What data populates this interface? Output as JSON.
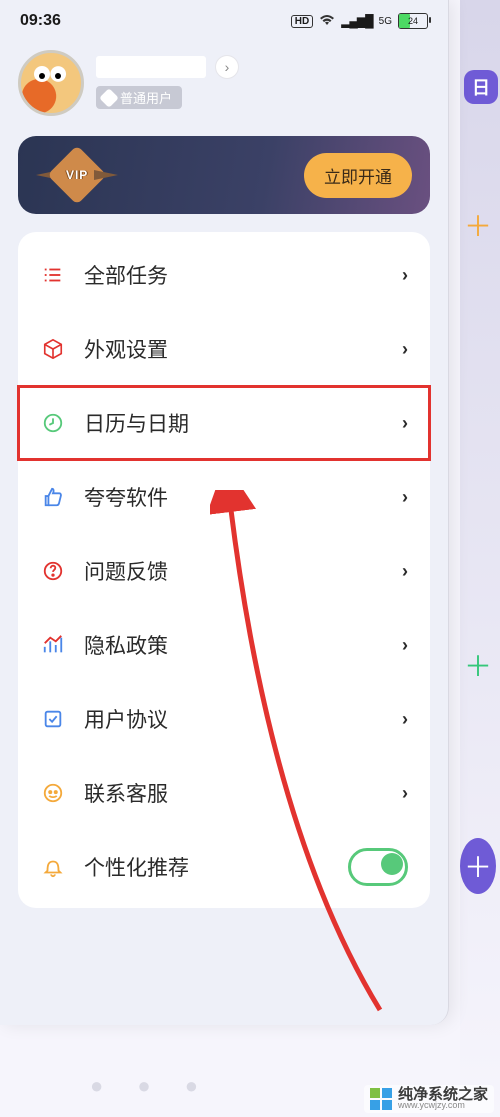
{
  "status": {
    "time": "09:36",
    "hd": "HD",
    "net": "5G",
    "battery": "24"
  },
  "profile": {
    "badge_label": "普通用户"
  },
  "vip": {
    "badge": "VIP",
    "cta": "立即开通"
  },
  "menu": {
    "all_tasks": {
      "label": "全部任务",
      "icon": "list-icon",
      "icon_color": "#e2332f"
    },
    "appearance": {
      "label": "外观设置",
      "icon": "cube-icon",
      "icon_color": "#e2332f"
    },
    "calendar": {
      "label": "日历与日期",
      "icon": "clock-icon",
      "icon_color": "#57c97a",
      "highlight": true
    },
    "rate": {
      "label": "夸夸软件",
      "icon": "thumbs-up-icon",
      "icon_color": "#4a86e8"
    },
    "feedback": {
      "label": "问题反馈",
      "icon": "question-icon",
      "icon_color": "#e2332f"
    },
    "privacy": {
      "label": "隐私政策",
      "icon": "chart-icon",
      "icon_color": "#4a86e8"
    },
    "agreement": {
      "label": "用户协议",
      "icon": "check-doc-icon",
      "icon_color": "#4a86e8"
    },
    "support": {
      "label": "联系客服",
      "icon": "headset-icon",
      "icon_color": "#f4a93b"
    },
    "personalize": {
      "label": "个性化推荐",
      "icon": "bell-icon",
      "icon_color": "#f4a93b",
      "toggle": true
    }
  },
  "bg": {
    "calendar_glyph": "日"
  },
  "watermark": {
    "brand": "纯净系统之家",
    "url": "www.ycwjzy.com"
  },
  "annotation": {
    "arrow_color": "#e2332f"
  }
}
